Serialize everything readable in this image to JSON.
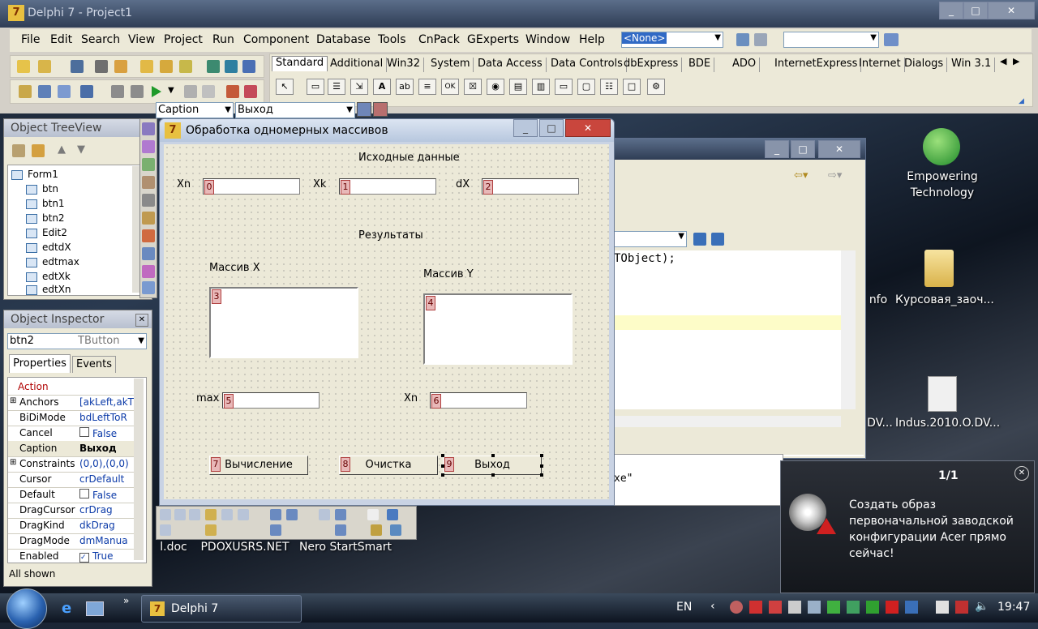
{
  "ide": {
    "title": "Delphi 7 - Project1",
    "menu": [
      "File",
      "Edit",
      "Search",
      "View",
      "Project",
      "Run",
      "Component",
      "Database",
      "Tools",
      "CnPack",
      "GExperts",
      "Window",
      "Help"
    ],
    "desktop_combo": "<None>",
    "palette_tabs": [
      "Standard",
      "Additional",
      "Win32",
      "System",
      "Data Access",
      "Data Controls",
      "dbExpress",
      "BDE",
      "ADO",
      "InternetExpress",
      "Internet",
      "Dialogs",
      "Win 3.1"
    ],
    "prop_combo": "Caption",
    "value_combo": "Выход"
  },
  "treeview": {
    "title": "Object TreeView",
    "items": [
      "Form1",
      "btn",
      "btn1",
      "btn2",
      "Edit2",
      "edtdX",
      "edtmax",
      "edtXk",
      "edtXn"
    ]
  },
  "inspector": {
    "title": "Object Inspector",
    "selected": "btn2",
    "selected_type": "TButton",
    "tabs": [
      "Properties",
      "Events"
    ],
    "rows": [
      {
        "k": "Action",
        "v": ""
      },
      {
        "k": "Anchors",
        "v": "[akLeft,akT"
      },
      {
        "k": "BiDiMode",
        "v": "bdLeftToR"
      },
      {
        "k": "Cancel",
        "v": "False"
      },
      {
        "k": "Caption",
        "v": "Выход"
      },
      {
        "k": "Constraints",
        "v": "(0,0),(0,0)"
      },
      {
        "k": "Cursor",
        "v": "crDefault"
      },
      {
        "k": "Default",
        "v": "False"
      },
      {
        "k": "DragCursor",
        "v": "crDrag"
      },
      {
        "k": "DragKind",
        "v": "dkDrag"
      },
      {
        "k": "DragMode",
        "v": "dmManua"
      },
      {
        "k": "Enabled",
        "v": "True"
      }
    ],
    "status": "All shown"
  },
  "form": {
    "title": "Обработка одномерных массивов",
    "source_label": "Исходные данные",
    "xn_label": "Xn",
    "xk_label": "Xk",
    "dx_label": "dX",
    "tag0": "0",
    "tag1": "1",
    "tag2": "2",
    "results_label": "Результаты",
    "arr_x_label": "Массив X",
    "arr_y_label": "Массив Y",
    "tag3": "3",
    "tag4": "4",
    "max_label": "max",
    "xn2_label": "Xn",
    "tag5": "5",
    "tag6": "6",
    "tag7": "7",
    "tag8": "8",
    "tag9": "9",
    "btn_calc": "Вычисление",
    "btn_clear": "Очистка",
    "btn_exit": "Выход"
  },
  "editor": {
    "code_line": "TObject);",
    "code_fragment": "xe\"",
    "info_fragment": "nfo"
  },
  "desktop": {
    "icon_empowering": "Empowering Technology",
    "icon_folder": "Курсовая_заоч...",
    "icon_avi": "Indus.2010.O.DV...",
    "icon_avi_prev": "DV...",
    "icon_doc": "l.doc",
    "icon_pdox": "PDOXUSRS.NET",
    "icon_nero": "Nero StartSmart"
  },
  "notification": {
    "counter": "1/1",
    "text": "Создать образ первоначальной заводской конфигурации Acer прямо сейчас!"
  },
  "taskbar": {
    "task": "Delphi 7",
    "lang": "EN",
    "clock": "19:47"
  }
}
